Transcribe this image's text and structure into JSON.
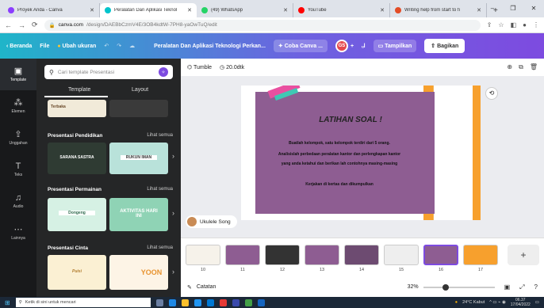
{
  "browser": {
    "tabs": [
      {
        "title": "Proyek Anda - Canva",
        "favicon_color": "#8b3dff",
        "active": false
      },
      {
        "title": "Peralatan Dan Aplikasi Teknol",
        "favicon_color": "#00c4cc",
        "active": true
      },
      {
        "title": "(49) WhatsApp",
        "favicon_color": "#25d366",
        "active": false
      },
      {
        "title": "YouTube",
        "favicon_color": "#ff0000",
        "active": false
      },
      {
        "title": "Writing help from start to fi",
        "favicon_color": "#e34c26",
        "active": false
      }
    ],
    "new_tab": "+",
    "window_controls": {
      "minimize": "–",
      "maximize": "❐",
      "close": "✕"
    },
    "url_domain": "canva.com",
    "url_path": "/design/DAEBbCzmV4E/3OB4kdtW-7PH8-yaOwTuQ/edit"
  },
  "topbar": {
    "home": "Beranda",
    "file": "File",
    "resize": "Ubah ukuran",
    "doc_title": "Peralatan Dan Aplikasi Teknologi Perkan...",
    "try_canva": "Coba Canva ...",
    "avatar": "GS",
    "avatar_plus": "+",
    "analytics": "ᵤl",
    "present": "Tampilkan",
    "share": "Bagikan"
  },
  "rail": [
    {
      "label": "Template",
      "icon": "▣",
      "active": true
    },
    {
      "label": "Elemen",
      "icon": "⁂",
      "active": false
    },
    {
      "label": "Unggahan",
      "icon": "⇪",
      "active": false
    },
    {
      "label": "Teks",
      "icon": "T",
      "active": false
    },
    {
      "label": "Audio",
      "icon": "♫",
      "active": false
    },
    {
      "label": "Lainnya",
      "icon": "⋯",
      "active": false
    }
  ],
  "panel": {
    "search_placeholder": "Cari template Presentasi",
    "tab_template": "Template",
    "tab_layout": "Layout",
    "top_thumb_label": "Terbaka",
    "sections": [
      {
        "title": "Presentasi Pendidikan",
        "see_all": "Lihat semua",
        "thumbs": [
          "SARANA SASTRA",
          "RUKUN IMAN"
        ]
      },
      {
        "title": "Presentasi Permainan",
        "see_all": "Lihat semua",
        "thumbs": [
          "Dongeng",
          "AKTIVITAS HARI INI"
        ]
      },
      {
        "title": "Presentasi Cinta",
        "see_all": "Lihat semua",
        "thumbs": [
          "Puisi",
          "YOON"
        ]
      }
    ]
  },
  "canvas_toolbar": {
    "transition": "Tumble",
    "duration": "20.0dtk"
  },
  "slide": {
    "title": "LATIHAN SOAL !",
    "lines": [
      "Buatlah kelompok, satu kelompok terdiri dari 5 orang.",
      "Analisislah perbedaan peralatan kantor dan perlengkapan kantor",
      "yang anda ketahui dan berikan lah contohnya masing-masing",
      "Kerjakan di kertas dan dikumpulkan"
    ]
  },
  "audio_chip": "Ukulele Song",
  "filmstrip": {
    "pages": [
      "10",
      "11",
      "12",
      "13",
      "14",
      "15",
      "16",
      "17"
    ],
    "selected": "16",
    "add": "+"
  },
  "footer": {
    "notes": "Catatan",
    "zoom_label": "32%",
    "zoom_fraction": 0.32
  },
  "taskbar": {
    "search": "Ketik di sini untuk mencari",
    "weather": "24°C Kabut",
    "time": "06.37",
    "date": "17/04/2022"
  }
}
